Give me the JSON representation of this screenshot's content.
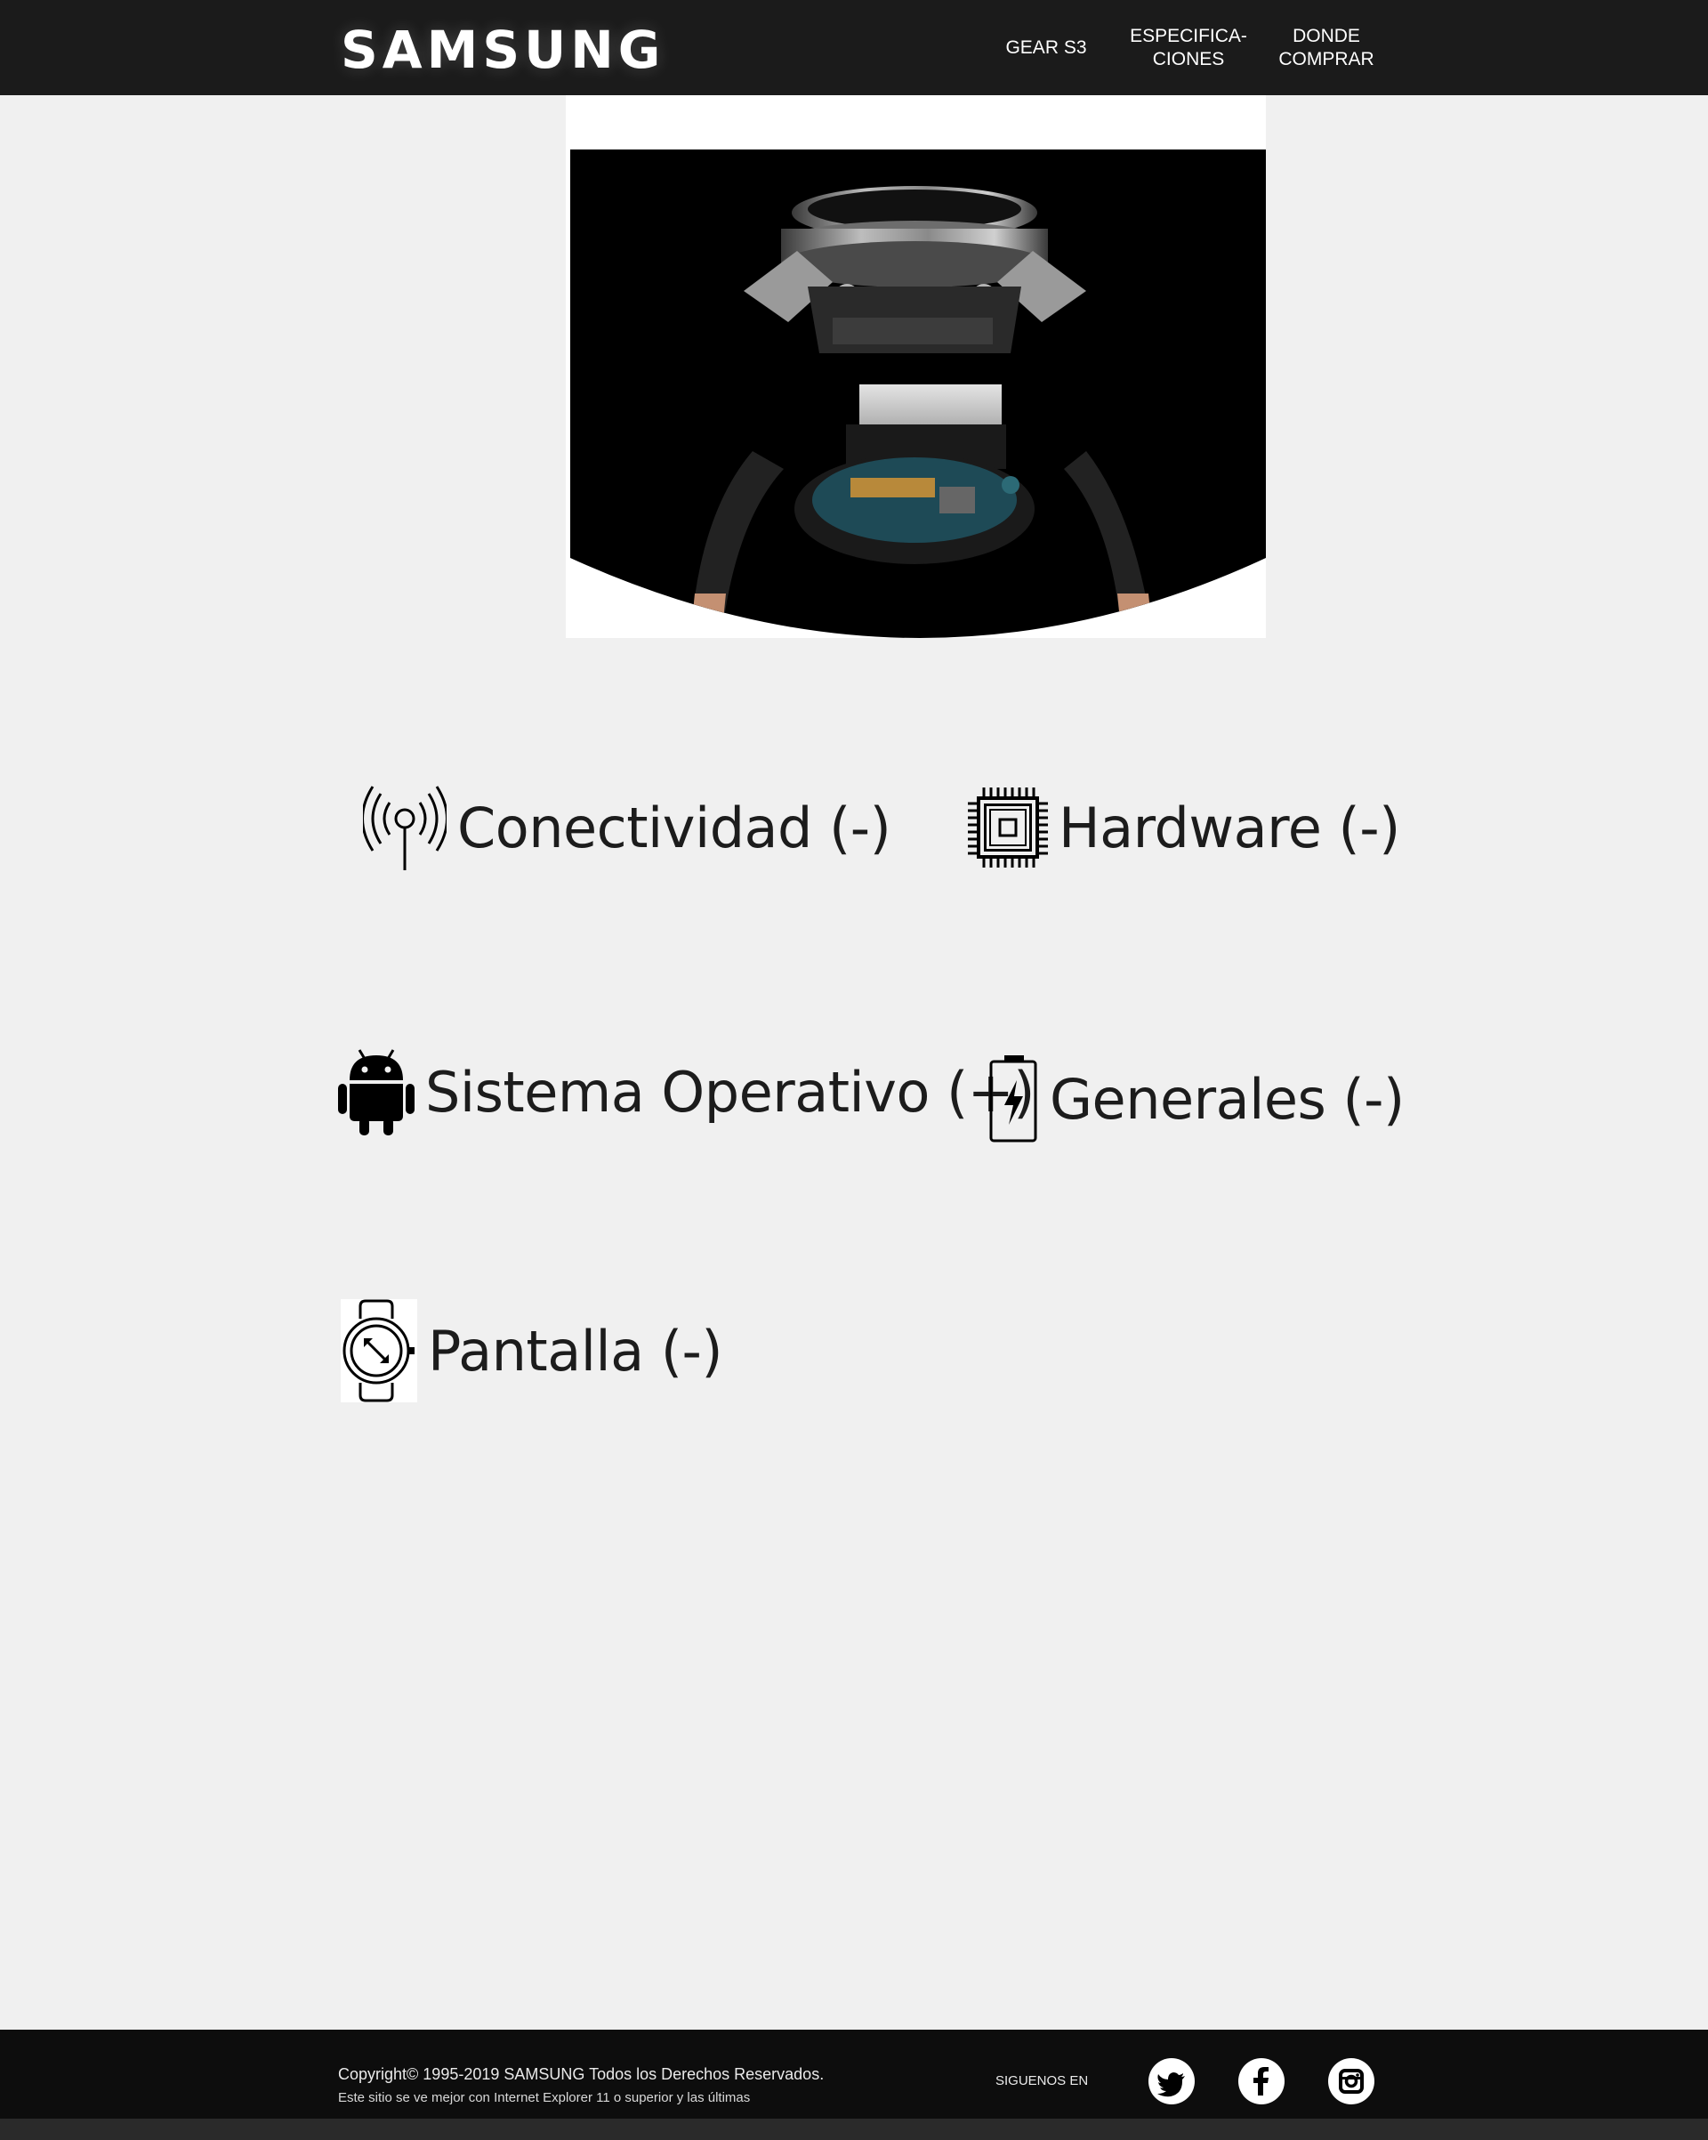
{
  "header": {
    "logo": "SAMSUNG",
    "nav": [
      {
        "label": "GEAR S3"
      },
      {
        "label": "ESPECIFICA-\nCIONES"
      },
      {
        "label": "DONDE\nCOMPRAR"
      }
    ]
  },
  "hero": {
    "image_subject": "exploded-view-smartwatch"
  },
  "specs": [
    {
      "label": "Conectividad (-)",
      "icon": "antenna-icon"
    },
    {
      "label": "Hardware (-)",
      "icon": "chip-icon"
    },
    {
      "label": "Sistema Operativo (+)",
      "icon": "android-icon"
    },
    {
      "label": "Generales (-)",
      "icon": "battery-icon"
    },
    {
      "label": "Pantalla (-)",
      "icon": "watch-icon"
    }
  ],
  "footer": {
    "copyright": "Copyright© 1995-2019 SAMSUNG Todos los Derechos Reservados.",
    "browser_note": "Este sitio se ve mejor con Internet Explorer 11 o superior y las últimas",
    "follow_label": "SIGUENOS EN",
    "social": [
      "twitter-icon",
      "facebook-icon",
      "instagram-icon"
    ]
  },
  "colors": {
    "header_bg": "#1b1b1b",
    "page_bg": "#f0f0f0",
    "footer_bg": "#0d0d0d",
    "text": "#1c1c1c"
  }
}
